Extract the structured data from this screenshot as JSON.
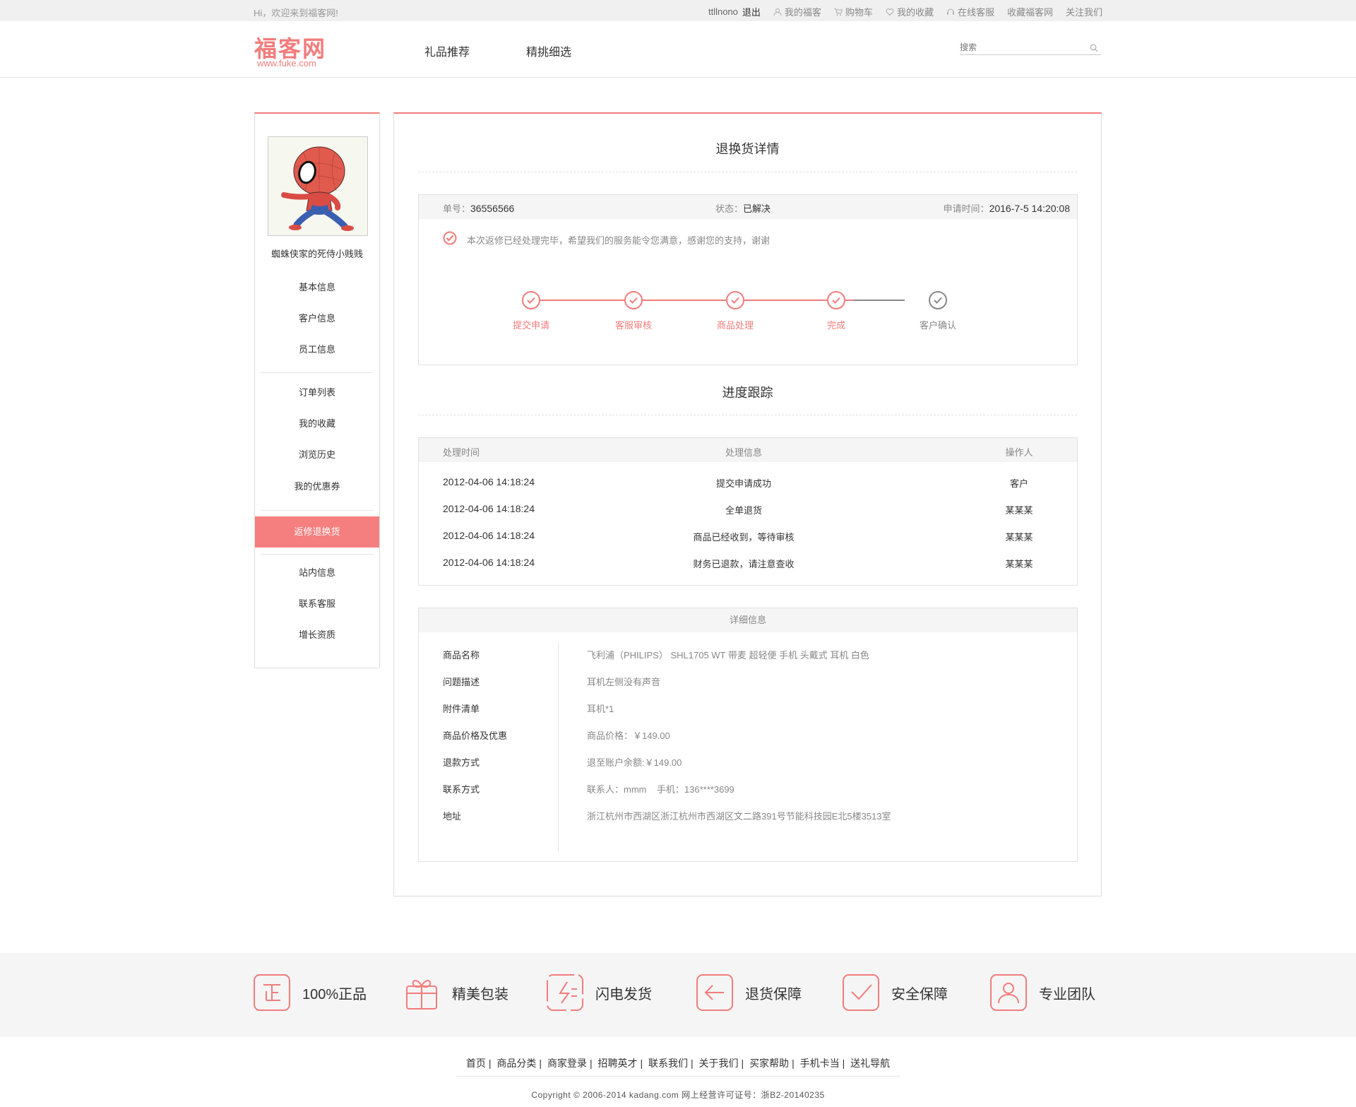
{
  "topbar": {
    "welcome": "Hi，欢迎来到福客网!",
    "username": "ttllnono",
    "logout": "退出",
    "my_fuke": "我的福客",
    "cart": "购物车",
    "favorites": "我的收藏",
    "online_service": "在线客服",
    "bookmark_site": "收藏福客网",
    "follow_us": "关注我们"
  },
  "header": {
    "logo_text": "福客网",
    "logo_url": "www.fuke.com",
    "nav": [
      "礼品推荐",
      "精挑细选"
    ],
    "search_placeholder": "搜索"
  },
  "sidebar": {
    "user_name": "蜘蛛侠家的死侍小贱贱",
    "groups": [
      [
        "基本信息",
        "客户信息",
        "员工信息"
      ],
      [
        "订单列表",
        "我的收藏",
        "浏览历史",
        "我的优惠券"
      ],
      [
        "返修退换货"
      ],
      [
        "站内信息",
        "联系客服",
        "增长资质"
      ]
    ],
    "active_item": "返修退换货"
  },
  "detail_page": {
    "title": "退换货详情",
    "summary": {
      "order_label": "单号：",
      "order_no": "36556566",
      "status_label": "状态：",
      "status": "已解决",
      "apply_time_label": "申请时间：",
      "apply_time": "2016-7-5 14:20:08",
      "notice": "本次返修已经处理完毕，希望我们的服务能令您满意，感谢您的支持，谢谢"
    },
    "steps": [
      {
        "label": "提交申请",
        "done": true
      },
      {
        "label": "客服审核",
        "done": true
      },
      {
        "label": "商品处理",
        "done": true
      },
      {
        "label": "完成",
        "done": true
      },
      {
        "label": "客户确认",
        "done": false
      }
    ],
    "tracking": {
      "title": "进度跟踪",
      "headers": [
        "处理时间",
        "处理信息",
        "操作人"
      ],
      "rows": [
        [
          "2012-04-06 14:18:24",
          "提交申请成功",
          "客户"
        ],
        [
          "2012-04-06 14:18:24",
          "全单退货",
          "某某某"
        ],
        [
          "2012-04-06 14:18:24",
          "商品已经收到，等待审核",
          "某某某"
        ],
        [
          "2012-04-06 14:18:24",
          "财务已退款，请注意查收",
          "某某某"
        ]
      ]
    },
    "details": {
      "title": "详细信息",
      "rows": [
        {
          "label": "商品名称",
          "value": "飞利浦（PHILIPS） SHL1705 WT 带麦 超轻便 手机 头戴式 耳机 白色"
        },
        {
          "label": "问题描述",
          "value": "耳机左侧没有声音"
        },
        {
          "label": "附件清单",
          "value": "耳机*1"
        },
        {
          "label": "商品价格及优惠",
          "value": "商品价格：￥149.00"
        },
        {
          "label": "退款方式",
          "value": "退至账户余额:￥149.00"
        },
        {
          "label": "联系方式",
          "value": "联系人：mmm    手机：136****3699"
        },
        {
          "label": "地址",
          "value": "浙江杭州市西湖区浙江杭州市西湖区文二路391号节能科技园E北5楼3513室"
        }
      ]
    }
  },
  "footer": {
    "features": [
      {
        "icon": "genuine-icon",
        "label": "100%正品"
      },
      {
        "icon": "gift-box-icon",
        "label": "精美包装"
      },
      {
        "icon": "lightning-icon",
        "label": "闪电发货"
      },
      {
        "icon": "return-arrow-icon",
        "label": "退货保障"
      },
      {
        "icon": "shield-check-icon",
        "label": "安全保障"
      },
      {
        "icon": "team-icon",
        "label": "专业团队"
      }
    ],
    "links": [
      "首页",
      "商品分类",
      "商家登录",
      "招聘英才",
      "联系我们",
      "关于我们",
      "买家帮助",
      "手机卡当",
      "送礼导航"
    ],
    "copyright": "Copyright © 2006-2014 kadang.com 网上经营许可证号：浙B2-20140235"
  },
  "colors": {
    "accent": "#f27c7c",
    "active_bg": "#f57f7f",
    "band_bg": "#f5f5f5"
  }
}
